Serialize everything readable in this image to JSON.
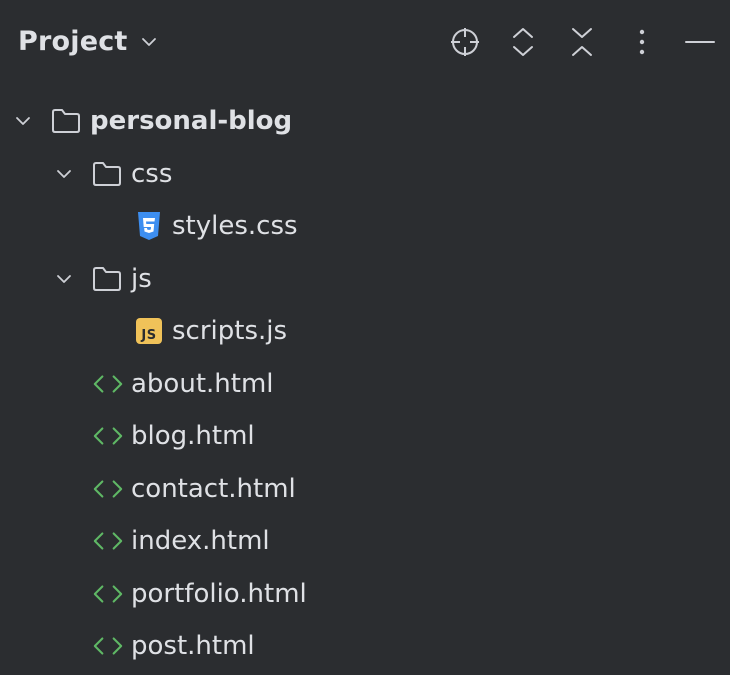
{
  "header": {
    "title": "Project",
    "tools": [
      {
        "name": "locate-icon"
      },
      {
        "name": "expand-all-icon"
      },
      {
        "name": "collapse-all-icon"
      },
      {
        "name": "more-options-icon"
      },
      {
        "name": "minimize-icon"
      }
    ]
  },
  "colors": {
    "background": "#2b2d30",
    "text": "#dfe1e5",
    "icon": "#ced0d6",
    "html_icon": "#5fb865",
    "css_icon": "#3d8ef0",
    "js_icon": "#f0c259"
  },
  "tree": {
    "root": {
      "label": "personal-blog",
      "expanded": true
    },
    "css_folder": {
      "label": "css",
      "expanded": true
    },
    "styles_css": {
      "label": "styles.css"
    },
    "js_folder": {
      "label": "js",
      "expanded": true
    },
    "scripts_js": {
      "label": "scripts.js",
      "badge": "JS"
    },
    "files": [
      {
        "label": "about.html"
      },
      {
        "label": "blog.html"
      },
      {
        "label": "contact.html"
      },
      {
        "label": "index.html"
      },
      {
        "label": "portfolio.html"
      },
      {
        "label": "post.html"
      }
    ]
  }
}
